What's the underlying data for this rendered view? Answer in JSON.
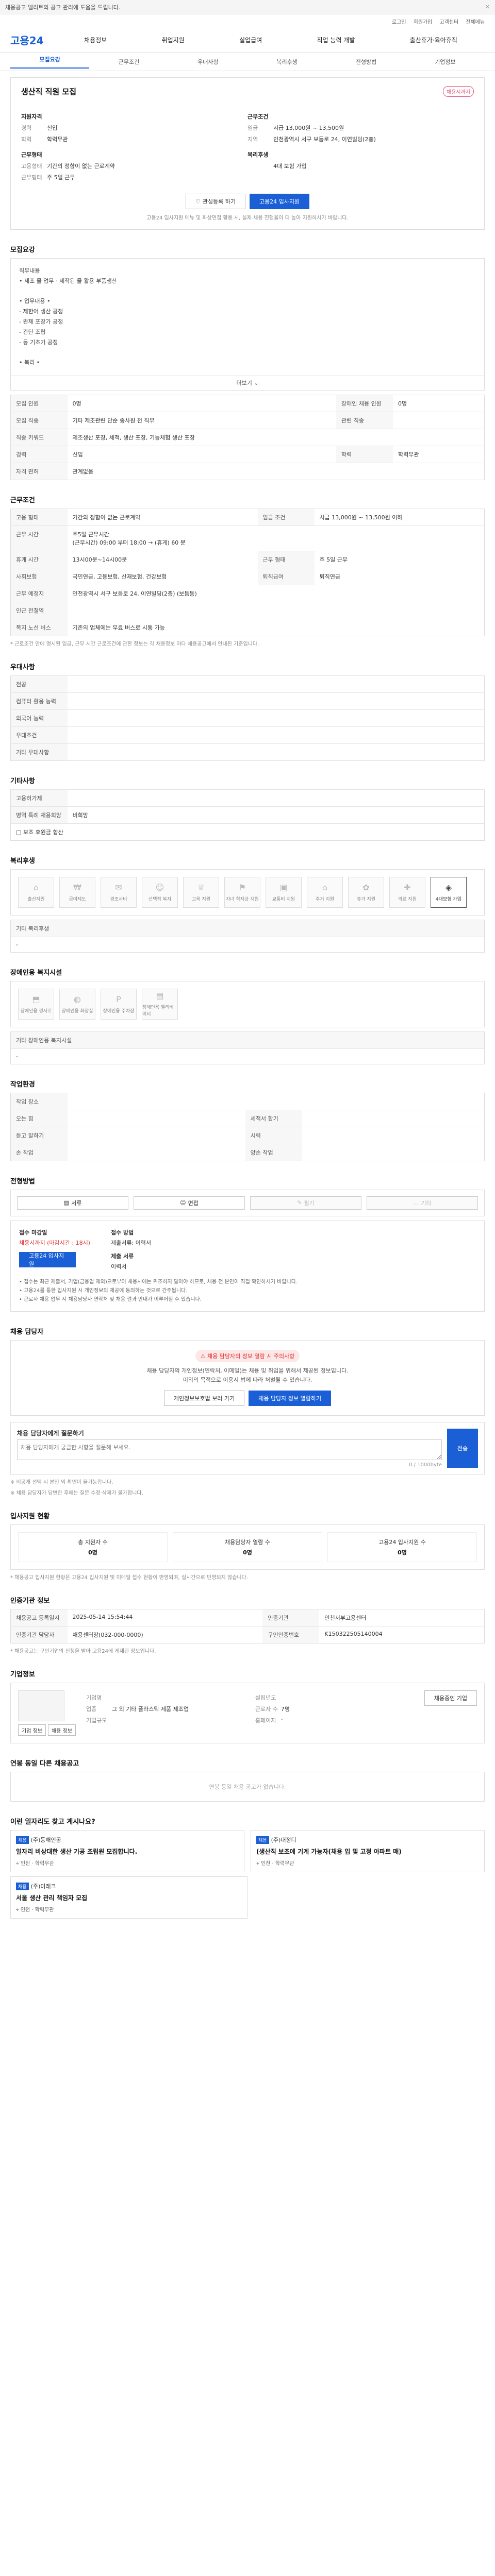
{
  "topbar": {
    "notice": "채용공고 엘리트의 공고 관리에 도움을 드립니다.",
    "close": "✕"
  },
  "util": [
    "로그인",
    "회원가입",
    "고객센터",
    "전체메뉴"
  ],
  "logo": "고용24",
  "gnb": [
    "채용정보",
    "취업지원",
    "실업급여",
    "직업 능력 개발",
    "출산휴가·육아휴직"
  ],
  "anchors": [
    "모집요강",
    "근무조건",
    "우대사항",
    "복리후생",
    "전형방법",
    "기업정보"
  ],
  "job": {
    "title": "생산직 직원 모집",
    "badge": "채용시까지",
    "left": {
      "label": "지원자격",
      "rows": [
        {
          "k": "경력",
          "v": "신입"
        },
        {
          "k": "학력",
          "v": "학력무관"
        }
      ],
      "cond_label": "근무형태",
      "cond": [
        {
          "k": "고용형태",
          "v": "기간의 정함이 없는 근로계약"
        },
        {
          "k": "근무형태",
          "v": "주 5일 근무"
        }
      ]
    },
    "right": {
      "label": "근무조건",
      "rows": [
        {
          "k": "임금",
          "v": "시급 13,000원 ~ 13,500원"
        },
        {
          "k": "지역",
          "v": "인천광역시 서구 보듬로 24, 이연빌딩(2층)"
        }
      ],
      "cond_label": "복리후생",
      "cond": [
        {
          "k": "",
          "v": "4대 보험 가입"
        }
      ]
    },
    "buttons": {
      "like": "관심등록 하기",
      "apply": "고용24 입사지원"
    },
    "note": "고용24 입사지원 메뉴 및 화상면접 활용 시, 실제 채용 진행율이 더 높아 지원하시기 바랍니다."
  },
  "recruit": {
    "section": "모집요강",
    "text": "직무내용\n• 제조 물 업무 · 제작된 물 활용 부품생산\n\n• 업무내용 •\n  - 제한어 생산 공정\n  - 완제 포장가 공정\n  - 간단 조립\n  - 등 기초기 공정\n\n• 복리 •",
    "more": "더보기",
    "table": [
      [
        {
          "k": "모집 인원",
          "v": "0명"
        },
        {
          "k": "장애인 채용 인원",
          "v": "0명"
        }
      ],
      [
        {
          "k": "모집 직종",
          "v": "기타 제조관련 단순 종사원 전 직무"
        },
        {
          "k": "관련 직종",
          "v": ""
        }
      ],
      [
        {
          "k": "직종 키워드",
          "v": "제조생산 포장, 세척, 생산 포장, 기능체험 생산 포장"
        },
        {
          "k": "",
          "v": ""
        }
      ],
      [
        {
          "k": "경력",
          "v": "신입"
        },
        {
          "k": "학력",
          "v": "학력무관"
        }
      ],
      [
        {
          "k": "자격 면허",
          "v": "관계없음"
        },
        {
          "k": "",
          "v": ""
        }
      ]
    ]
  },
  "work": {
    "section": "근무조건",
    "table": [
      [
        {
          "k": "고용 형태",
          "v": "기간의 정함이 없는 근로계약"
        },
        {
          "k": "임금 조건",
          "v": "시급 13,000원 ~ 13,500원 이하"
        }
      ],
      [
        {
          "k": "근무 시간",
          "v": "주5일 근무시간\n(근무시간) 09:00 부터 18:00 → (휴게) 60 분"
        },
        {
          "k": "",
          "v": ""
        }
      ],
      [
        {
          "k": "휴게 시간",
          "v": "13시00분~14시00분"
        },
        {
          "k": "근무 형태",
          "v": "주 5일 근무"
        }
      ],
      [
        {
          "k": "사회보험",
          "v": "국민연금, 고용보험, 산재보험, 건강보험"
        },
        {
          "k": "퇴직급여",
          "v": "퇴직연금"
        }
      ],
      [
        {
          "k": "근무 예정지",
          "v": "인천광역시 서구 보듬로 24, 이연빌딩(2층) (보듬동)"
        },
        {
          "k": "",
          "v": ""
        }
      ],
      [
        {
          "k": "인근 전철역",
          "v": ""
        },
        {
          "k": "",
          "v": ""
        }
      ],
      [
        {
          "k": "복지 노선 버스",
          "v": "기존의 업체에는 무료 버스로 시통 가능"
        },
        {
          "k": "",
          "v": ""
        }
      ]
    ],
    "foot": "* 근로조건 안에 명시된 임금, 근무 시간 근로조건에 관한 정보는 각 채용정보 마다 채용공고에서 안내된 기준입니다."
  },
  "pref": {
    "section": "우대사항",
    "rows": [
      {
        "k": "전공",
        "v": ""
      },
      {
        "k": "컴퓨터 활용 능력",
        "v": ""
      },
      {
        "k": "외국어 능력",
        "v": ""
      },
      {
        "k": "우대조건",
        "v": ""
      },
      {
        "k": "기타 우대사항",
        "v": ""
      }
    ]
  },
  "other": {
    "section": "기타사항",
    "rows": [
      {
        "k": "고용허가제",
        "v": ""
      },
      {
        "k": "병역 특례 채용희망",
        "v": "비희망"
      }
    ],
    "check": "□ 보조 후원금 합산"
  },
  "welfare": {
    "section": "복리후생",
    "icons": [
      {
        "icon": "home-icon",
        "g": "⌂",
        "label": "출산지원",
        "on": false
      },
      {
        "icon": "money-icon",
        "g": "₩",
        "label": "급여제도",
        "on": false
      },
      {
        "icon": "gift-icon",
        "g": "✉",
        "label": "경조사비",
        "on": false
      },
      {
        "icon": "family-icon",
        "g": "☺",
        "label": "선택적 복지",
        "on": false
      },
      {
        "icon": "medal-icon",
        "g": "♕",
        "label": "교육 지원",
        "on": false
      },
      {
        "icon": "cap-icon",
        "g": "⚑",
        "label": "자녀 학자금 지원",
        "on": false
      },
      {
        "icon": "bus-icon",
        "g": "▣",
        "label": "교통비 지원",
        "on": false
      },
      {
        "icon": "house-icon",
        "g": "⌂",
        "label": "주거 지원",
        "on": false
      },
      {
        "icon": "leaf-icon",
        "g": "✿",
        "label": "휴가 지원",
        "on": false
      },
      {
        "icon": "care-icon",
        "g": "✚",
        "label": "의료 지원",
        "on": false
      },
      {
        "icon": "insurance-icon",
        "g": "◈",
        "label": "4대보험 가입",
        "on": true
      }
    ],
    "etc": "기타 복리후생",
    "etc_value": "-"
  },
  "disabled": {
    "section": "장애인용 복지시설",
    "icons": [
      {
        "icon": "ramp-icon",
        "g": "⬒",
        "label": "장애인용 경사로"
      },
      {
        "icon": "toilet-icon",
        "g": "◍",
        "label": "장애인용 화장실"
      },
      {
        "icon": "parking-icon",
        "g": "P",
        "label": "장애인용 주차장"
      },
      {
        "icon": "elevator-icon",
        "g": "▤",
        "label": "장애인용 엘리베이터"
      }
    ],
    "etc": "기타 장애인용 복지시설",
    "etc_value": "-"
  },
  "env": {
    "section": "작업환경",
    "table": [
      [
        {
          "k": "작업 장소",
          "v": ""
        },
        {
          "k": "",
          "v": ""
        }
      ],
      [
        {
          "k": "오는 힘",
          "v": ""
        },
        {
          "k": "세척서 합기",
          "v": ""
        }
      ],
      [
        {
          "k": "듣고 말하기",
          "v": ""
        },
        {
          "k": "시력",
          "v": ""
        }
      ],
      [
        {
          "k": "손 작업",
          "v": ""
        },
        {
          "k": "양손 작업",
          "v": ""
        }
      ]
    ]
  },
  "select": {
    "section": "전형방법",
    "methods": [
      {
        "icon": "doc-icon",
        "g": "▤",
        "label": "서류",
        "on": true
      },
      {
        "icon": "interview-icon",
        "g": "☺",
        "label": "면접",
        "on": true
      },
      {
        "icon": "test-icon",
        "g": "✎",
        "label": "필기",
        "on": false
      },
      {
        "icon": "etc-icon",
        "g": "…",
        "label": "기타",
        "on": false
      }
    ],
    "deadline_label": "접수 마감일",
    "deadline": "채용시까지 (마감시간 : 18시)",
    "apply_btn": "고용24 입사지원",
    "method_label": "접수 방법",
    "method": "제출서류: 이력서",
    "doc_label": "제출 서류",
    "doc": "이력서",
    "bullets": [
      "• 접수는 최근 제출서, 기업(금융업 제외)으로부터 채용시에는 위조하지 말아야 하므로, 채용 전 본인이 직접 확인하시기 바랍니다.",
      "• 고용24를 통한 입사지원 시 개인정보의 제공에 동의하는 것으로 간주됩니다.",
      "• 근로자 채용 업무 시 채용담당자 연락처 및 채용 결과 안내가 이루어질 수 있습니다."
    ]
  },
  "manager": {
    "section": "채용 담당자",
    "warn": "채용 담당자의 정보 열람 시 주의사항",
    "msg": "채용 담당자의 개인정보(연락처, 이메일)는 채용 및 취업을 위해서 제공된 정보입니다.\n이외의 목적으로 이용시 법에 따라 처벌될 수 있습니다.",
    "btn1": "개인정보보호법 보러 가기",
    "btn2": "채용 담당자 정보 열람하기",
    "qa_title": "채용 담당자에게 질문하기",
    "qa_placeholder": "채용 담당자에게 궁금한 사항을 질문해 보세요.",
    "qa_count": "0 / 1000byte",
    "qa_send": "전송",
    "qa_notes": [
      "※ 비공개 선택 시 본인 외 확인이 불가능합니다.",
      "※ 채용 담당자가 답변한 후에는 질문 수정·삭제가 불가합니다."
    ]
  },
  "stats": {
    "section": "입사지원 현황",
    "more": "더보기",
    "items": [
      {
        "label": "총 지원자 수",
        "value": "0명"
      },
      {
        "label": "채용담당자 열람 수",
        "value": "0명"
      },
      {
        "label": "고용24 입사지원 수",
        "value": "0명"
      }
    ],
    "foot": "* 채용공고 입사지원 현황은 고용24 입사지원 및 이메일 접수 현황이 반영되며, 실시간으로 반영되지 않습니다."
  },
  "info": {
    "section": "인증기관 정보",
    "table": [
      [
        {
          "k": "채용공고 등록일시",
          "v": "2025-05-14 15:54:44"
        },
        {
          "k": "인증기관",
          "v": "인천서부고용센터"
        }
      ],
      [
        {
          "k": "인증기관 담당자",
          "v": "채용센터장(032-000-0000)"
        },
        {
          "k": "구인인증번호",
          "v": "K150322505140004"
        }
      ]
    ],
    "foot": "* 채용공고는 구인기업의 신청을 받아 고용24에 게재된 정보입니다."
  },
  "company": {
    "section": "기업정보",
    "btn": "채용중인 기업",
    "name_k": "기업명",
    "name": "",
    "industry_k": "업종",
    "industry": "그 외 기타 플라스틱 제품 제조업",
    "addr_k": "기업규모",
    "addr": "",
    "emp_k": "근로자 수",
    "emp": "7명",
    "found_k": "설립년도",
    "found": "",
    "homepage_k": "홈페이지",
    "homepage": "-",
    "links": [
      "기업 정보",
      "채용 정보"
    ]
  },
  "similar": {
    "section": "연봉 동일 다른 채용공고",
    "empty": "연봉 동일 채용 공고가 없습니다."
  },
  "recommend": {
    "section": "이런 일자리도 찾고 계시나요?",
    "items": [
      {
        "tag": "채용",
        "co": "(주)동해인공",
        "title": "일자리 비상대한 생산 기공 조립원 모집합니다.",
        "loc": "인천",
        "type": "학력무관"
      },
      {
        "tag": "채용",
        "co": "(주)대정디",
        "title": "(생산직 보조에 기계 가능자(채용 입 및 고정 아파트 매)",
        "loc": "인천",
        "type": "학력무관"
      },
      {
        "tag": "채용",
        "co": "(주)미래크",
        "title": "서울 생산 관리 책임자 모집",
        "loc": "인천",
        "type": "학력무관"
      }
    ]
  }
}
